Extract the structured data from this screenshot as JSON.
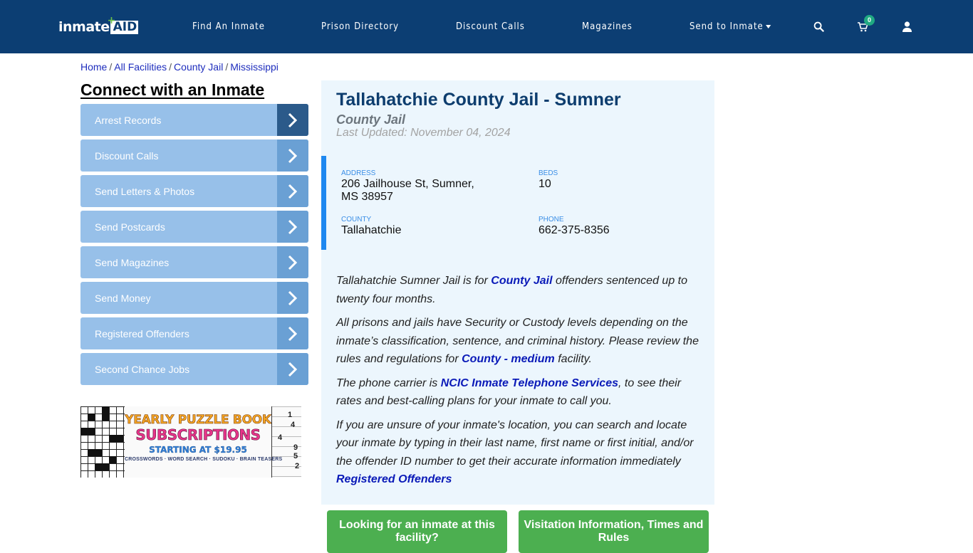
{
  "header": {
    "logo": {
      "text_main": "inmate",
      "text_accent": "AID",
      "plus": "+"
    },
    "nav": [
      {
        "label": "Find An Inmate"
      },
      {
        "label": "Prison Directory"
      },
      {
        "label": "Discount Calls"
      },
      {
        "label": "Magazines"
      },
      {
        "label": "Send to Inmate",
        "has_dropdown": true
      }
    ],
    "icons": {
      "search": "search-icon",
      "cart": "cart-icon",
      "user": "user-icon"
    },
    "cart_count": "0",
    "colors": {
      "background": "#0c3e73",
      "badge": "#20a982"
    }
  },
  "breadcrumb": [
    {
      "label": "Home"
    },
    {
      "label": "All Facilities"
    },
    {
      "label": "County Jail"
    },
    {
      "label": "Mississippi"
    }
  ],
  "breadcrumb_separator": "/",
  "sidebar": {
    "title": "Connect with an Inmate",
    "items": [
      {
        "label": "Arrest Records"
      },
      {
        "label": "Discount Calls"
      },
      {
        "label": "Send Letters & Photos"
      },
      {
        "label": "Send Postcards"
      },
      {
        "label": "Send Magazines"
      },
      {
        "label": "Send Money"
      },
      {
        "label": "Registered Offenders"
      },
      {
        "label": "Second Chance Jobs"
      }
    ],
    "ad": {
      "line1": "YEARLY PUZZLE BOOK",
      "line2": "SUBSCRIPTIONS",
      "line3": "STARTING AT $19.95",
      "line4": "CROSSWORDS · WORD SEARCH · SUDOKU · BRAIN TEASERS",
      "sudoku_digits": [
        "1",
        "4",
        "4",
        "9",
        "5",
        "2"
      ]
    }
  },
  "facility": {
    "title": "Tallahatchie County Jail - Sumner",
    "type": "County Jail",
    "last_updated": "Last Updated: November 04, 2024",
    "info": {
      "address_label": "ADDRESS",
      "address_line1": "206 Jailhouse St, Sumner,",
      "address_line2": "MS 38957",
      "beds_label": "BEDS",
      "beds": "10",
      "county_label": "COUNTY",
      "county": "Tallahatchie",
      "phone_label": "PHONE",
      "phone": "662-375-8356"
    },
    "description": {
      "p1_before": "Tallahatchie Sumner Jail is for ",
      "p1_link": "County Jail",
      "p1_after": " offenders sentenced up to twenty four months.",
      "p2_before": "All prisons and jails have Security or Custody levels depending on the inmate’s classification, sentence, and criminal history. Please review the rules and regulations for ",
      "p2_link": "County - medium",
      "p2_after": " facility.",
      "p3_before": "The phone carrier is ",
      "p3_link": "NCIC Inmate Telephone Services",
      "p3_after": ", to see their rates and best-calling plans for your inmate to call you.",
      "p4_text": "If you are unsure of your inmate's location, you can search and locate your inmate by typing in their last name, first name or first initial, and/or the offender ID number to get their accurate information immediately",
      "p4_link": "Registered Offenders"
    }
  },
  "cta_buttons": [
    {
      "label": "Looking for an inmate at this facility?"
    },
    {
      "label": "Visitation Information, Times and Rules"
    }
  ]
}
